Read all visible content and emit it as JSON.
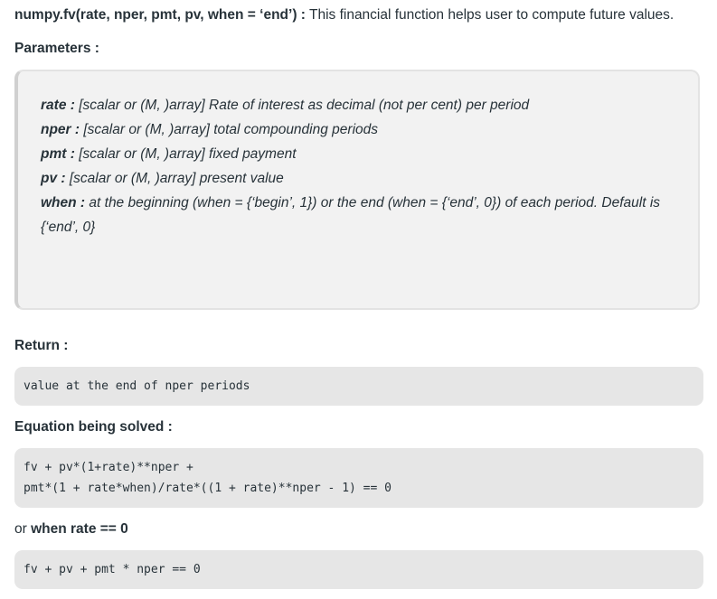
{
  "intro": {
    "signature": "numpy.fv(rate, nper, pmt, pv, when = ‘end’) :",
    "description": " This financial function helps user to compute future values."
  },
  "parameters": {
    "heading": "Parameters :",
    "items": [
      {
        "name": "rate :",
        "desc": " [scalar or (M, )array] Rate of interest as decimal (not per cent) per period"
      },
      {
        "name": "nper :",
        "desc": " [scalar or (M, )array] total compounding periods"
      },
      {
        "name": "pmt :",
        "desc": " [scalar or (M, )array] fixed payment"
      },
      {
        "name": "pv :",
        "desc": " [scalar or (M, )array] present value"
      },
      {
        "name": "when :",
        "desc": " at the beginning (when = {‘begin’, 1}) or the end (when = {‘end’, 0}) of each period. Default is {‘end’, 0}"
      }
    ]
  },
  "return": {
    "heading": "Return :",
    "code": "value at the end of nper periods"
  },
  "equation": {
    "heading": "Equation being solved :",
    "lines": [
      "fv + pv*(1+rate)**nper +",
      "pmt*(1 + rate*when)/rate*((1 + rate)**nper - 1) == 0"
    ]
  },
  "zero_rate": {
    "prefix": "or ",
    "heading": "when rate == 0",
    "code": "fv + pv + pmt * nper == 0"
  }
}
